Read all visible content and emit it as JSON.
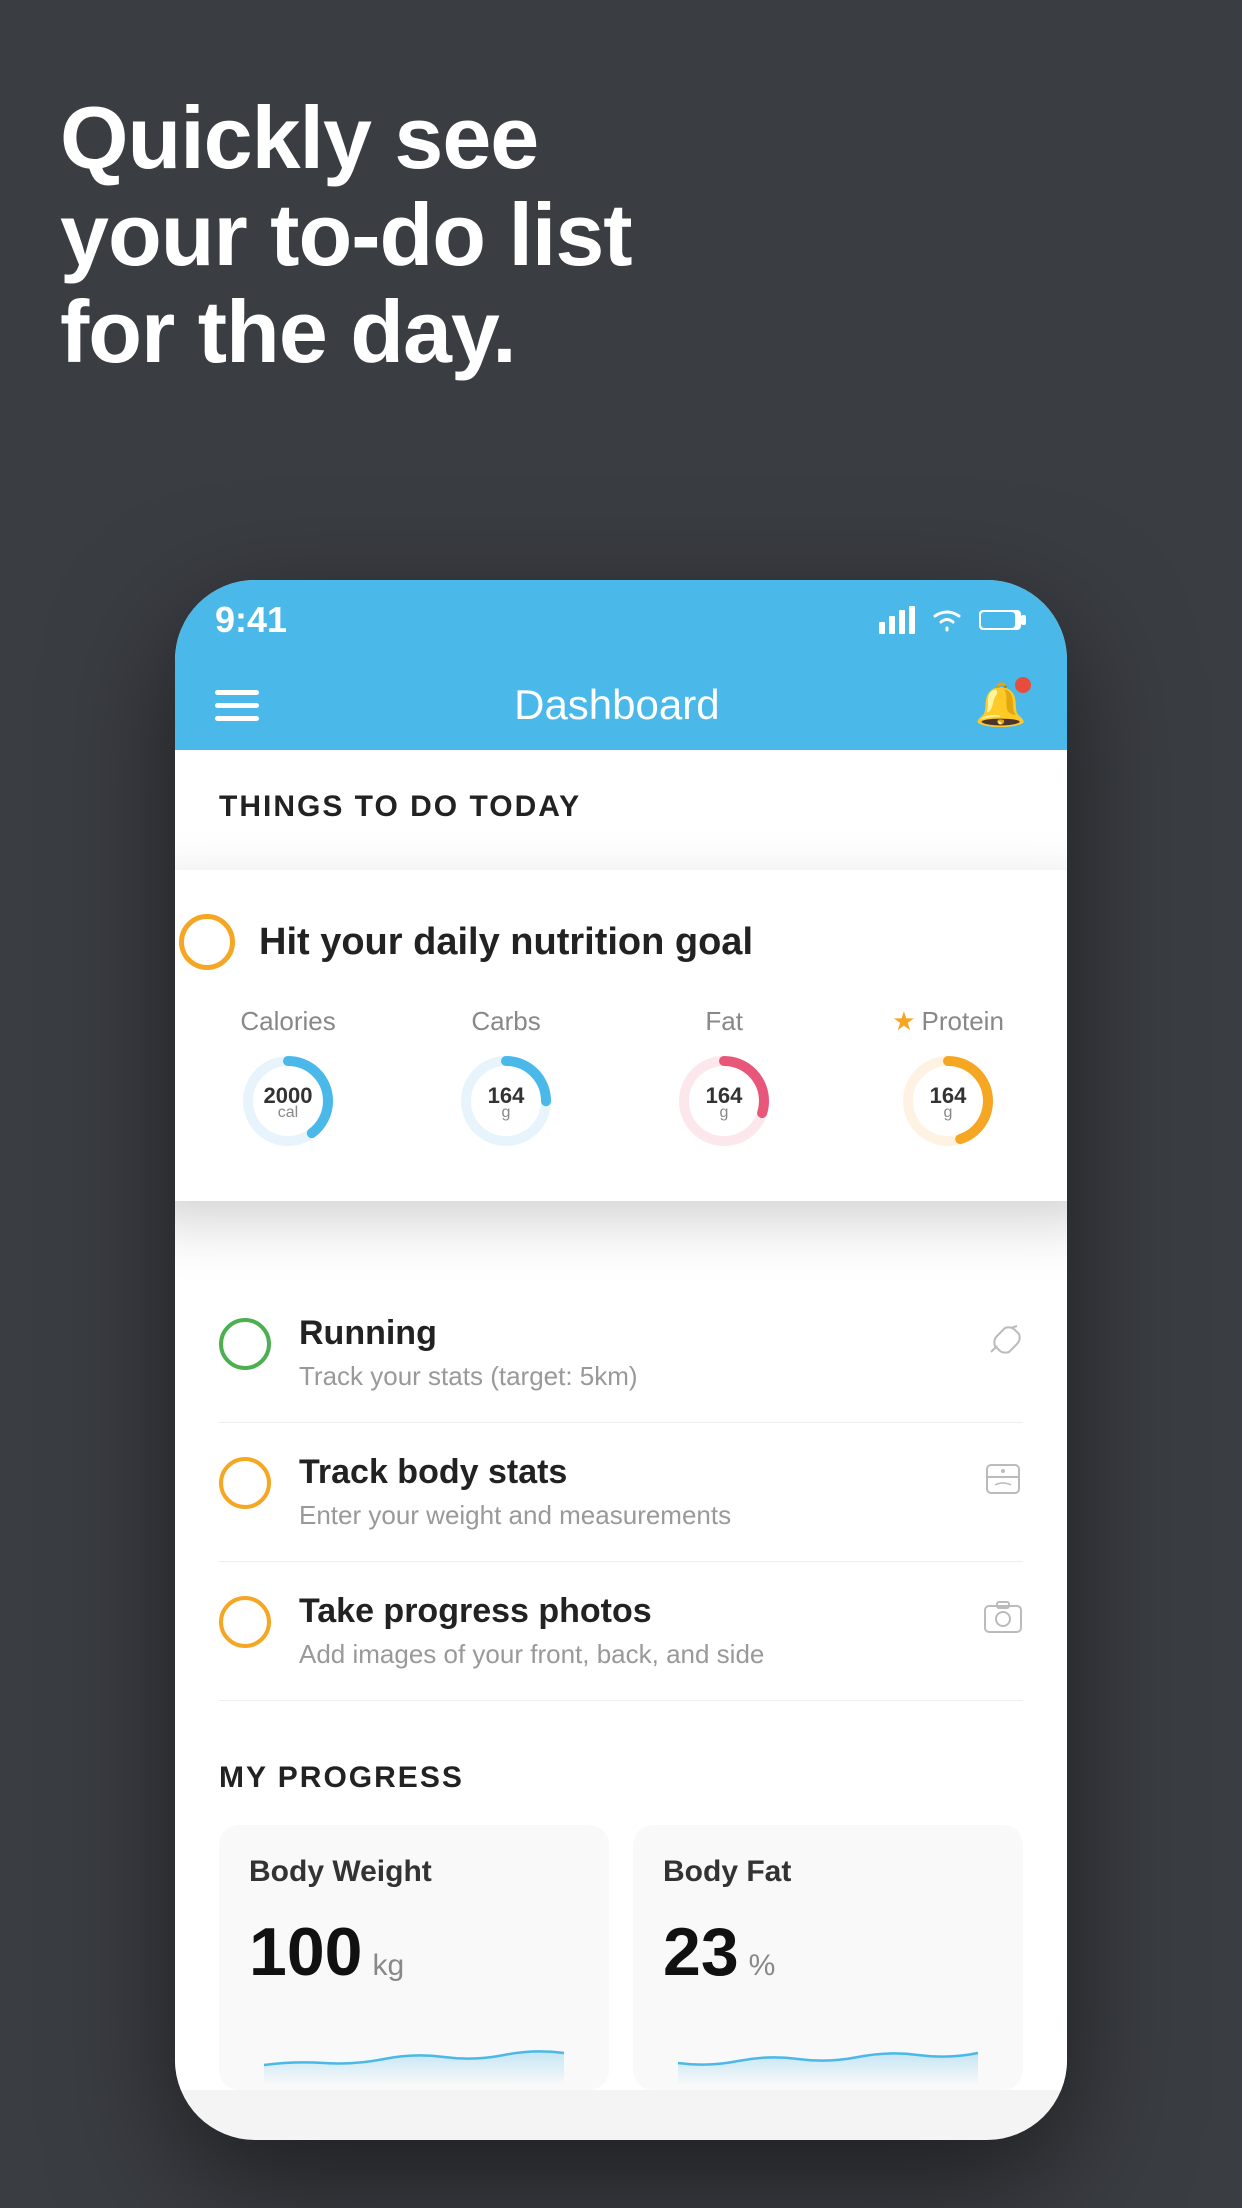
{
  "headline": {
    "line1": "Quickly see",
    "line2": "your to-do list",
    "line3": "for the day."
  },
  "status_bar": {
    "time": "9:41"
  },
  "nav": {
    "title": "Dashboard"
  },
  "things_header": "THINGS TO DO TODAY",
  "floating_card": {
    "title": "Hit your daily nutrition goal",
    "macros": [
      {
        "label": "Calories",
        "value": "2000",
        "unit": "cal",
        "color": "#4ab8e8",
        "track": 0.65
      },
      {
        "label": "Carbs",
        "value": "164",
        "unit": "g",
        "color": "#4ab8e8",
        "track": 0.5
      },
      {
        "label": "Fat",
        "value": "164",
        "unit": "g",
        "color": "#e8567a",
        "track": 0.55
      },
      {
        "label": "Protein",
        "value": "164",
        "unit": "g",
        "color": "#f5a623",
        "track": 0.7,
        "starred": true
      }
    ]
  },
  "todo_items": [
    {
      "title": "Running",
      "subtitle": "Track your stats (target: 5km)",
      "circle_color": "green",
      "icon": "👟"
    },
    {
      "title": "Track body stats",
      "subtitle": "Enter your weight and measurements",
      "circle_color": "yellow",
      "icon": "⚖"
    },
    {
      "title": "Take progress photos",
      "subtitle": "Add images of your front, back, and side",
      "circle_color": "yellow",
      "icon": "🖼"
    }
  ],
  "progress": {
    "header": "MY PROGRESS",
    "cards": [
      {
        "title": "Body Weight",
        "value": "100",
        "unit": "kg"
      },
      {
        "title": "Body Fat",
        "value": "23",
        "unit": "%"
      }
    ]
  }
}
